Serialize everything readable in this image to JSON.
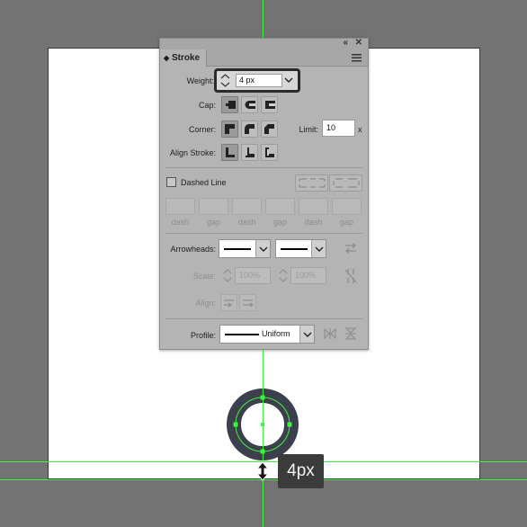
{
  "panel": {
    "tab": "Stroke",
    "weight": {
      "label": "Weight:",
      "value": "4 px"
    },
    "cap": {
      "label": "Cap:"
    },
    "corner": {
      "label": "Corner:",
      "limit_label": "Limit:",
      "limit_value": "10",
      "limit_suffix": "x"
    },
    "align_stroke": {
      "label": "Align Stroke:"
    },
    "dashed": {
      "label": "Dashed Line",
      "fields": [
        "dash",
        "gap",
        "dash",
        "gap",
        "dash",
        "gap"
      ]
    },
    "arrowheads": {
      "label": "Arrowheads:"
    },
    "scale": {
      "label": "Scale:",
      "start": "100%",
      "end": "100%"
    },
    "align": {
      "label": "Align:"
    },
    "profile": {
      "label": "Profile:",
      "value": "Uniform"
    }
  },
  "canvas": {
    "tooltip": "4px"
  },
  "colors": {
    "ring": "#3c3f4c",
    "selection": "#3ef23e",
    "canvas": "#737373",
    "panel": "#b4b4b4"
  },
  "icons": [
    "collapse-icon",
    "close-icon",
    "panel-menu-icon",
    "spinner-icon",
    "dropdown-icon",
    "butt-cap-icon",
    "round-cap-icon",
    "projecting-cap-icon",
    "miter-join-icon",
    "round-join-icon",
    "bevel-join-icon",
    "align-center-icon",
    "align-inside-icon",
    "align-outside-icon",
    "swap-arrows-icon",
    "link-scale-icon",
    "flip-profile-icon",
    "resize-cursor-icon"
  ]
}
